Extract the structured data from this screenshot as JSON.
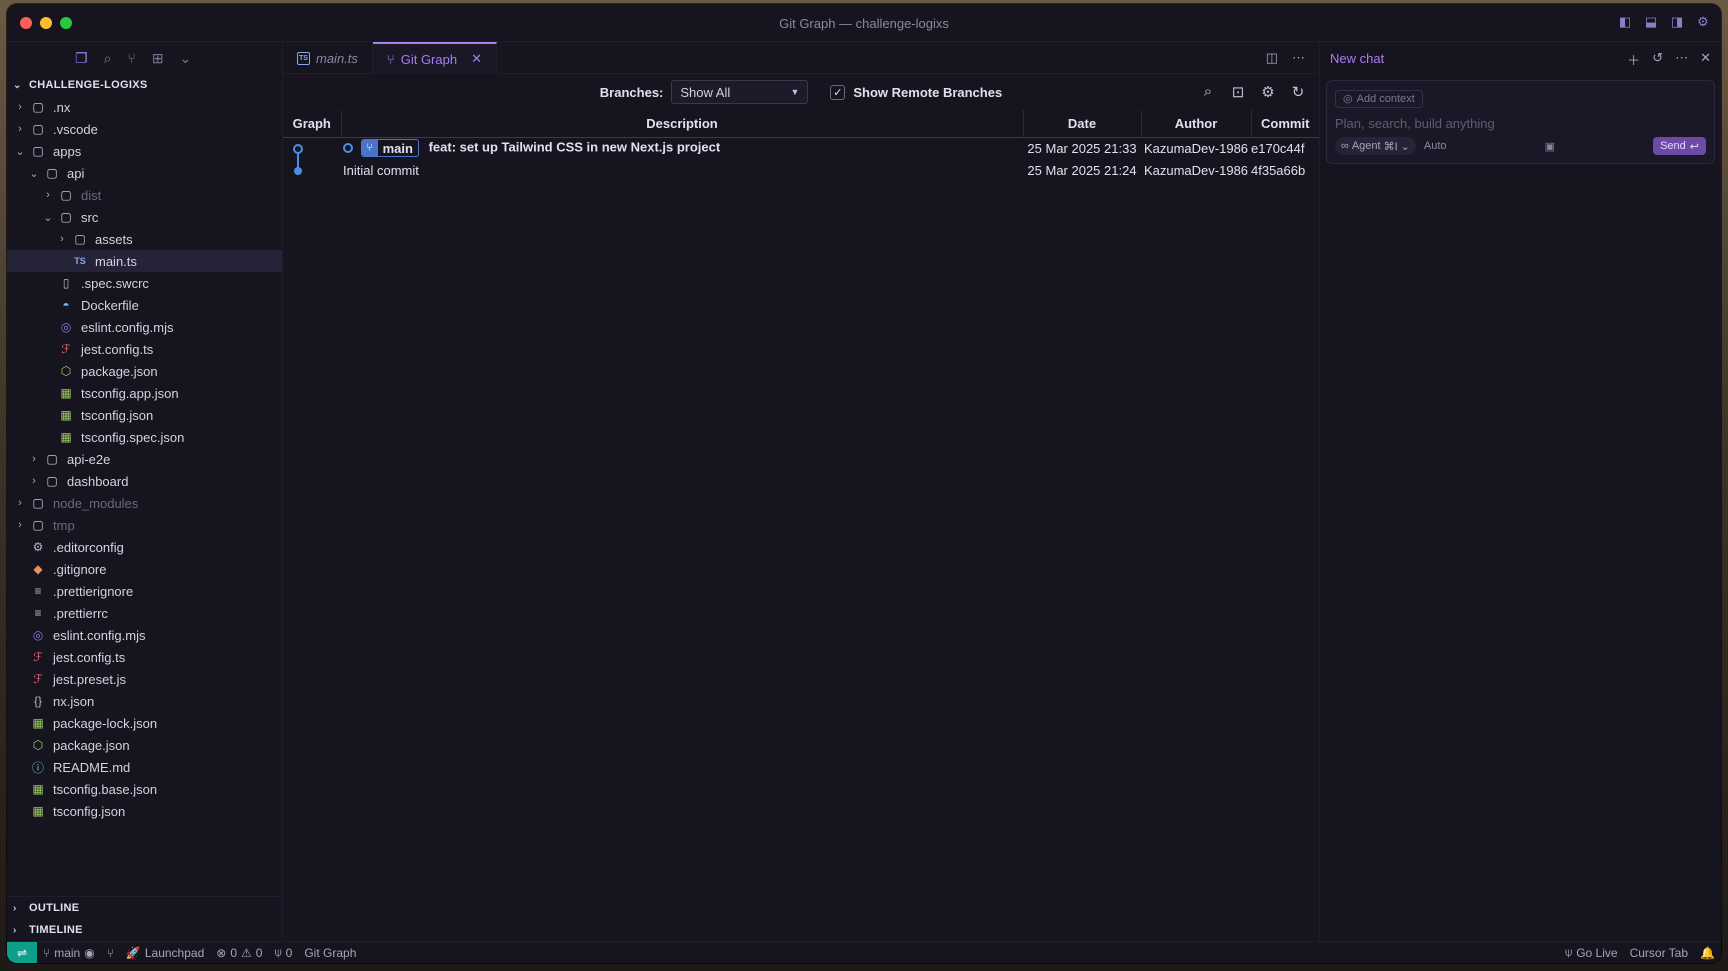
{
  "window": {
    "title": "Git Graph — challenge-logixs"
  },
  "sidebar": {
    "section_title": "CHALLENGE-LOGIXS",
    "tree": [
      {
        "label": ".nx",
        "indent": 1,
        "chevron": "›",
        "icon": "nx-folder-icon",
        "glyph": "▢",
        "dim": false
      },
      {
        "label": ".vscode",
        "indent": 1,
        "chevron": "›",
        "icon": "vscode-folder-icon",
        "glyph": "▢",
        "dim": false
      },
      {
        "label": "apps",
        "indent": 1,
        "chevron": "⌄",
        "icon": "apps-folder-icon",
        "glyph": "▢",
        "dim": false
      },
      {
        "label": "api",
        "indent": 2,
        "chevron": "⌄",
        "icon": "api-folder-icon",
        "glyph": "▢",
        "dim": false
      },
      {
        "label": "dist",
        "indent": 3,
        "chevron": "›",
        "icon": "dist-folder-icon",
        "glyph": "▢",
        "dim": true
      },
      {
        "label": "src",
        "indent": 3,
        "chevron": "⌄",
        "icon": "src-folder-icon",
        "glyph": "▢",
        "dim": false
      },
      {
        "label": "assets",
        "indent": 4,
        "chevron": "›",
        "icon": "assets-folder-icon",
        "glyph": "▢",
        "dim": false
      },
      {
        "label": "main.ts",
        "indent": 4,
        "chevron": "",
        "icon": "typescript-file-icon",
        "glyph": "TS",
        "dim": false,
        "selected": true
      },
      {
        "label": ".spec.swcrc",
        "indent": 3,
        "chevron": "",
        "icon": "file-icon",
        "glyph": "▯",
        "dim": false
      },
      {
        "label": "Dockerfile",
        "indent": 3,
        "chevron": "",
        "icon": "docker-icon",
        "glyph": "◓",
        "dim": false
      },
      {
        "label": "eslint.config.mjs",
        "indent": 3,
        "chevron": "",
        "icon": "eslint-icon",
        "glyph": "◎",
        "dim": false
      },
      {
        "label": "jest.config.ts",
        "indent": 3,
        "chevron": "",
        "icon": "jest-icon",
        "glyph": "ℱ",
        "dim": false
      },
      {
        "label": "package.json",
        "indent": 3,
        "chevron": "",
        "icon": "package-json-icon",
        "glyph": "⬡",
        "dim": false
      },
      {
        "label": "tsconfig.app.json",
        "indent": 3,
        "chevron": "",
        "icon": "tsconfig-icon",
        "glyph": "▦",
        "dim": false
      },
      {
        "label": "tsconfig.json",
        "indent": 3,
        "chevron": "",
        "icon": "tsconfig-icon",
        "glyph": "▦",
        "dim": false
      },
      {
        "label": "tsconfig.spec.json",
        "indent": 3,
        "chevron": "",
        "icon": "tsconfig-icon",
        "glyph": "▦",
        "dim": false
      },
      {
        "label": "api-e2e",
        "indent": 2,
        "chevron": "›",
        "icon": "folder-icon",
        "glyph": "▢",
        "dim": false
      },
      {
        "label": "dashboard",
        "indent": 2,
        "chevron": "›",
        "icon": "folder-icon",
        "glyph": "▢",
        "dim": false
      },
      {
        "label": "node_modules",
        "indent": 1,
        "chevron": "›",
        "icon": "node-modules-folder-icon",
        "glyph": "▢",
        "dim": true
      },
      {
        "label": "tmp",
        "indent": 1,
        "chevron": "›",
        "icon": "tmp-folder-icon",
        "glyph": "▢",
        "dim": true
      },
      {
        "label": ".editorconfig",
        "indent": 1,
        "chevron": "",
        "icon": "editorconfig-icon",
        "glyph": "⚙",
        "dim": false
      },
      {
        "label": ".gitignore",
        "indent": 1,
        "chevron": "",
        "icon": "git-icon",
        "glyph": "◆",
        "dim": false
      },
      {
        "label": ".prettierignore",
        "indent": 1,
        "chevron": "",
        "icon": "prettier-icon",
        "glyph": "≡",
        "dim": false
      },
      {
        "label": ".prettierrc",
        "indent": 1,
        "chevron": "",
        "icon": "prettier-icon",
        "glyph": "≡",
        "dim": false
      },
      {
        "label": "eslint.config.mjs",
        "indent": 1,
        "chevron": "",
        "icon": "eslint-icon",
        "glyph": "◎",
        "dim": false
      },
      {
        "label": "jest.config.ts",
        "indent": 1,
        "chevron": "",
        "icon": "jest-icon",
        "glyph": "ℱ",
        "dim": false
      },
      {
        "label": "jest.preset.js",
        "indent": 1,
        "chevron": "",
        "icon": "jest-icon",
        "glyph": "ℱ",
        "dim": false
      },
      {
        "label": "nx.json",
        "indent": 1,
        "chevron": "",
        "icon": "json-braces-icon",
        "glyph": "{}",
        "dim": false
      },
      {
        "label": "package-lock.json",
        "indent": 1,
        "chevron": "",
        "icon": "package-lock-icon",
        "glyph": "▦",
        "dim": false
      },
      {
        "label": "package.json",
        "indent": 1,
        "chevron": "",
        "icon": "package-json-icon",
        "glyph": "⬡",
        "dim": false
      },
      {
        "label": "README.md",
        "indent": 1,
        "chevron": "",
        "icon": "info-icon",
        "glyph": "ⓘ",
        "dim": false
      },
      {
        "label": "tsconfig.base.json",
        "indent": 1,
        "chevron": "",
        "icon": "tsconfig-icon",
        "glyph": "▦",
        "dim": false
      },
      {
        "label": "tsconfig.json",
        "indent": 1,
        "chevron": "",
        "icon": "tsconfig-icon",
        "glyph": "▦",
        "dim": false
      }
    ],
    "outline_label": "OUTLINE",
    "timeline_label": "TIMELINE"
  },
  "tabs": [
    {
      "label": "main.ts",
      "active": false
    },
    {
      "label": "Git Graph",
      "active": true
    }
  ],
  "git_graph": {
    "branches_label": "Branches:",
    "branches_value": "Show All",
    "show_remote_label": "Show Remote Branches",
    "show_remote_checked": true,
    "columns": {
      "graph": "Graph",
      "description": "Description",
      "date": "Date",
      "author": "Author",
      "commit": "Commit"
    },
    "commits": [
      {
        "branch": "main",
        "message": "feat: set up Tailwind CSS in new Next.js project",
        "date": "25 Mar 2025 21:33",
        "author": "KazumaDev-1986",
        "hash": "e170c44f"
      },
      {
        "branch": "",
        "message": "Initial commit",
        "date": "25 Mar 2025 21:24",
        "author": "KazumaDev-1986",
        "hash": "4f35a66b"
      }
    ]
  },
  "chat": {
    "title": "New chat",
    "add_context": "Add context",
    "placeholder": "Plan, search, build anything",
    "agent_label": "Agent",
    "agent_shortcut": "⌘I",
    "model_label": "Auto",
    "send_label": "Send"
  },
  "statusbar": {
    "branch": "main",
    "launchpad": "Launchpad",
    "errors": "0",
    "warnings": "0",
    "ports": "0",
    "git_graph": "Git Graph",
    "go_live": "Go Live",
    "cursor_tab": "Cursor Tab"
  },
  "colors": {
    "accent": "#a77cf0",
    "branch_badge": "#4a73c9",
    "remote": "#0e9f8a"
  }
}
